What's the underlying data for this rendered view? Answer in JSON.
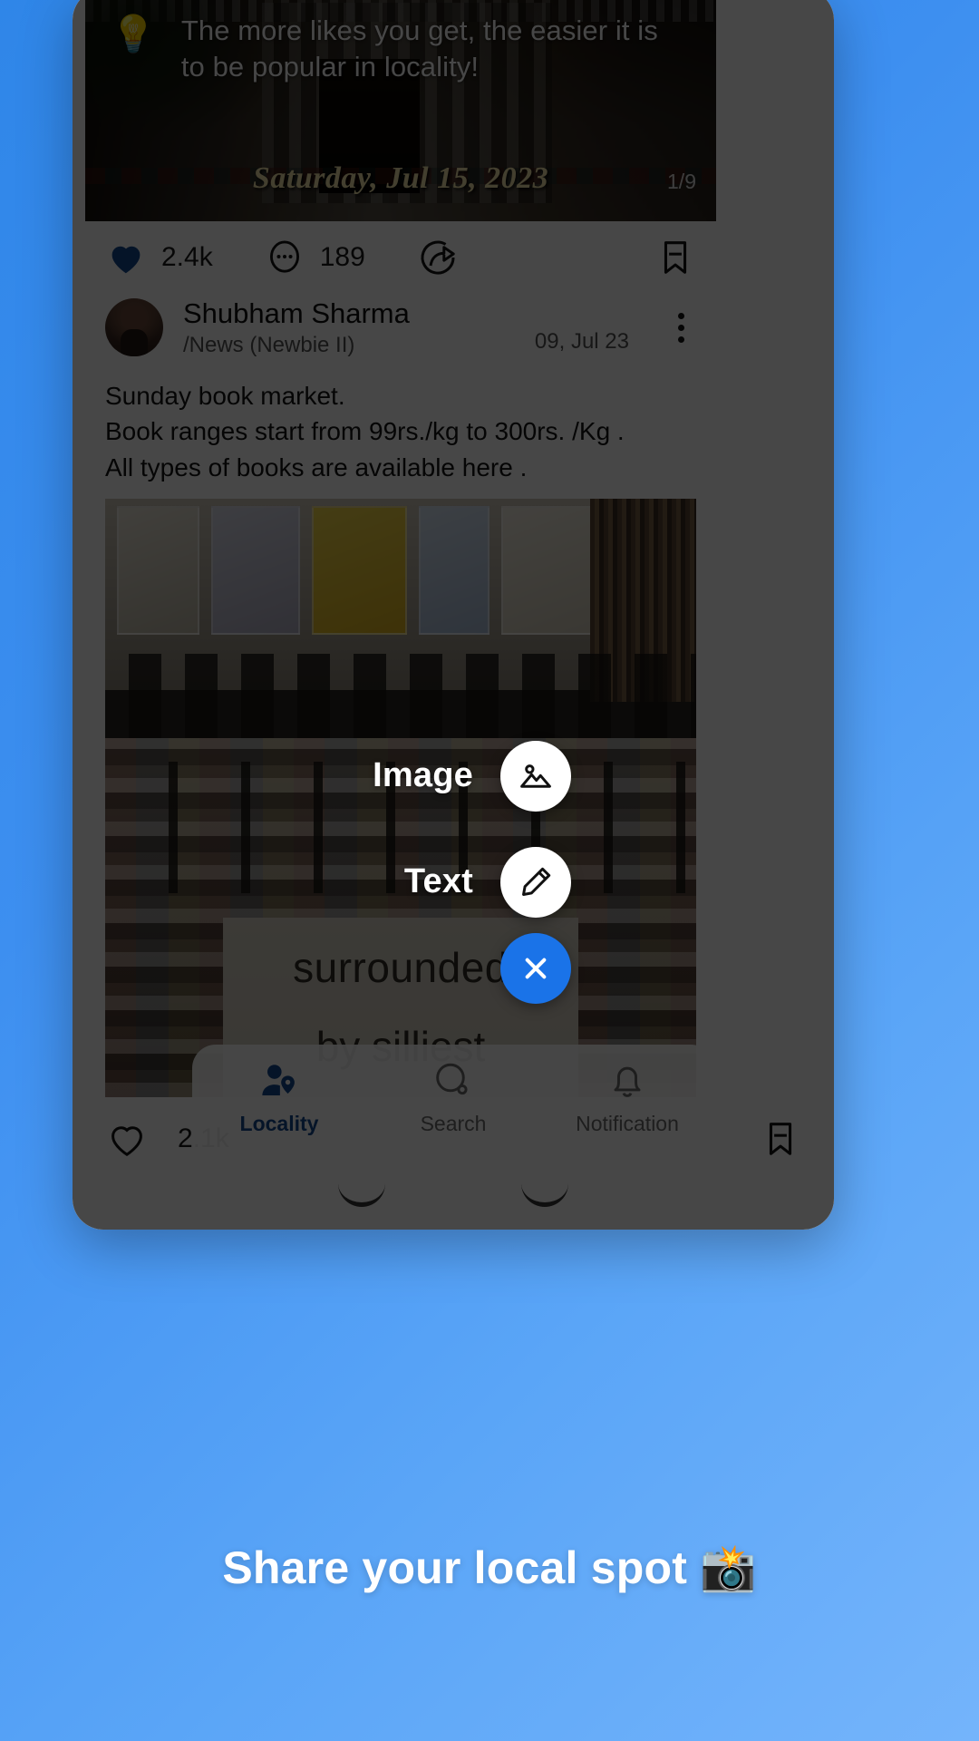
{
  "tip_card": {
    "icon": "lightbulb-icon",
    "text": "The more likes you get, the easier it is to be popular in locality!",
    "date_overlay": "Saturday, Jul 15, 2023",
    "image_counter": "1/9"
  },
  "post_one_actions": {
    "like_icon": "heart-filled-icon",
    "like_count": "2.4k",
    "comment_icon": "comment-dots-icon",
    "comment_count": "189",
    "share_icon": "share-arrow-icon",
    "bookmark_icon": "bookmark-icon",
    "like_color": "#14498f"
  },
  "post_two": {
    "avatar": "user-avatar",
    "username": "Shubham Sharma",
    "community": "/News (Newbie II)",
    "date": "09, Jul 23",
    "menu_icon": "kebab-menu-icon",
    "body": "Sunday book market.\nBook ranges start from 99rs./kg to 300rs. /Kg .\nAll types of books are available here .",
    "photo_text_line1": "surrounded",
    "photo_text_line2": "by silliest",
    "like_icon": "heart-outline-icon",
    "like_count": "2.1k",
    "bookmark_icon": "bookmark-icon"
  },
  "fab_menu": {
    "items": [
      {
        "label": "Image",
        "icon": "image-icon",
        "style": "white"
      },
      {
        "label": "Text",
        "icon": "pencil-icon",
        "style": "white"
      }
    ],
    "close": {
      "label": "",
      "icon": "close-icon",
      "style": "blue",
      "color": "#1a73e8"
    }
  },
  "bottom_nav": {
    "items": [
      {
        "label": "Locality",
        "icon": "person-pin-icon",
        "active": true
      },
      {
        "label": "Search",
        "icon": "search-icon",
        "active": false
      },
      {
        "label": "Notification",
        "icon": "bell-icon",
        "active": false
      }
    ],
    "active_color": "#14498f"
  },
  "caption": {
    "text": "Share your local spot 📸"
  },
  "colors": {
    "background_top": "#2f86e8",
    "background_bottom": "#74b4fb",
    "accent": "#1a73e8"
  }
}
